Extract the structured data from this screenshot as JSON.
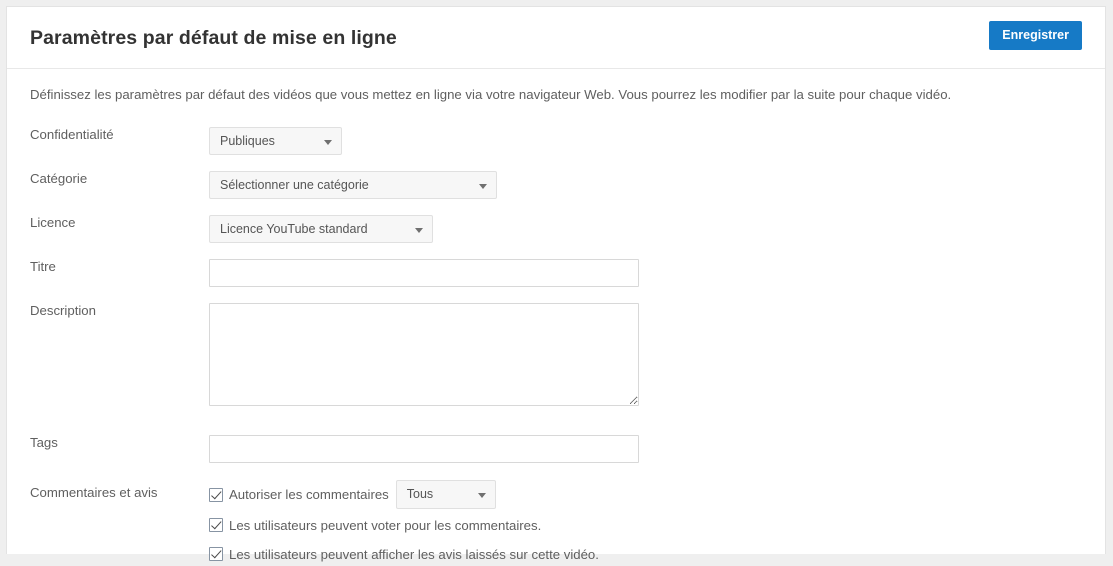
{
  "header": {
    "title": "Paramètres par défaut de mise en ligne",
    "save_label": "Enregistrer",
    "accent_color": "#167ac6"
  },
  "intro": {
    "text": "Définissez les paramètres par défaut des vidéos que vous mettez en ligne via votre navigateur Web. Vous pourrez les modifier par la suite pour chaque vidéo."
  },
  "form": {
    "privacy": {
      "label": "Confidentialité",
      "selected": "Publiques"
    },
    "category": {
      "label": "Catégorie",
      "selected": "Sélectionner une catégorie"
    },
    "license": {
      "label": "Licence",
      "selected": "Licence YouTube standard"
    },
    "title_field": {
      "label": "Titre",
      "value": "",
      "placeholder": ""
    },
    "description_field": {
      "label": "Description",
      "value": "",
      "placeholder": ""
    },
    "tags_field": {
      "label": "Tags",
      "value": "",
      "placeholder": ""
    },
    "comments": {
      "label": "Commentaires et avis",
      "allow_comments": {
        "label": "Autoriser les commentaires",
        "checked": true
      },
      "comments_mode": {
        "selected": "Tous"
      },
      "can_vote": {
        "label": "Les utilisateurs peuvent voter pour les commentaires.",
        "checked": true
      },
      "can_view_reviews": {
        "label": "Les utilisateurs peuvent afficher les avis laissés sur cette vidéo.",
        "checked": true
      }
    }
  }
}
